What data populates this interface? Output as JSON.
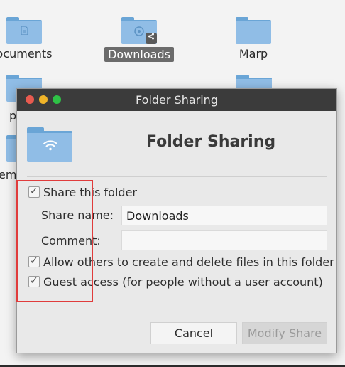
{
  "desktop": {
    "files": [
      {
        "label": "ocuments",
        "emblem": "document-icon",
        "selected": false
      },
      {
        "label": "Downloads",
        "emblem": "download-icon",
        "selected": true,
        "shared": true
      },
      {
        "label": "Marp",
        "emblem": "",
        "selected": false
      }
    ],
    "partial_labels": [
      "p",
      "em"
    ]
  },
  "dialog": {
    "window_title": "Folder Sharing",
    "heading": "Folder Sharing",
    "share_folder": {
      "label": "Share this folder",
      "checked": true
    },
    "share_name": {
      "label": "Share name:",
      "value": "Downloads"
    },
    "comment": {
      "label": "Comment:",
      "value": ""
    },
    "allow_others": {
      "label": "Allow others to create and delete files in this folder",
      "checked": true
    },
    "guest_access": {
      "label": "Guest access (for people without a user account)",
      "checked": true
    },
    "buttons": {
      "cancel": "Cancel",
      "modify": "Modify Share"
    }
  },
  "colors": {
    "folder": "#90bde6",
    "folder_dark": "#6aa5d6",
    "annotation": "#e03c3c",
    "titlebar": "#3b3b3b"
  }
}
